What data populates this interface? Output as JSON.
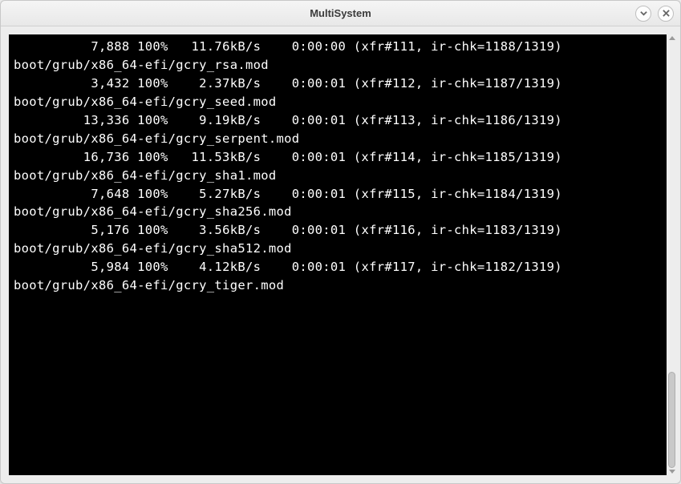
{
  "window": {
    "title": "MultiSystem"
  },
  "terminal": {
    "lines": [
      "          7,888 100%   11.76kB/s    0:00:00 (xfr#111, ir-chk=1188/1319)",
      "boot/grub/x86_64-efi/gcry_rsa.mod",
      "          3,432 100%    2.37kB/s    0:00:01 (xfr#112, ir-chk=1187/1319)",
      "boot/grub/x86_64-efi/gcry_seed.mod",
      "         13,336 100%    9.19kB/s    0:00:01 (xfr#113, ir-chk=1186/1319)",
      "boot/grub/x86_64-efi/gcry_serpent.mod",
      "         16,736 100%   11.53kB/s    0:00:01 (xfr#114, ir-chk=1185/1319)",
      "boot/grub/x86_64-efi/gcry_sha1.mod",
      "          7,648 100%    5.27kB/s    0:00:01 (xfr#115, ir-chk=1184/1319)",
      "boot/grub/x86_64-efi/gcry_sha256.mod",
      "          5,176 100%    3.56kB/s    0:00:01 (xfr#116, ir-chk=1183/1319)",
      "boot/grub/x86_64-efi/gcry_sha512.mod",
      "          5,984 100%    4.12kB/s    0:00:01 (xfr#117, ir-chk=1182/1319)",
      "boot/grub/x86_64-efi/gcry_tiger.mod",
      ""
    ]
  }
}
